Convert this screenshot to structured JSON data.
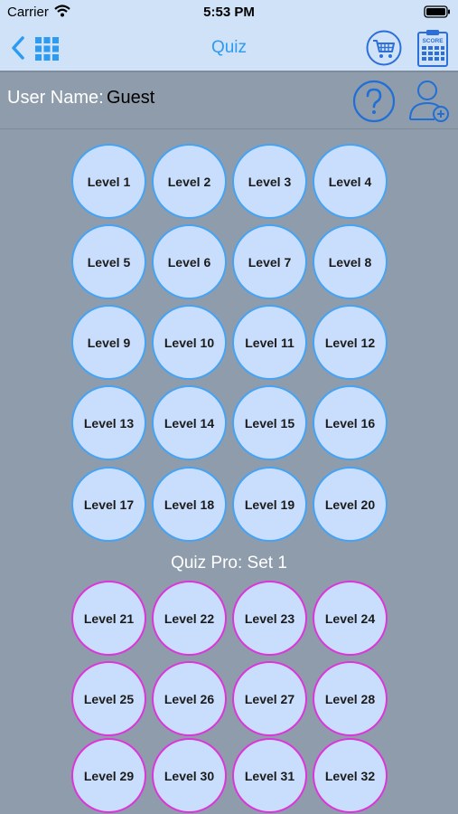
{
  "status_bar": {
    "carrier": "Carrier",
    "time": "5:53 PM",
    "wifi_icon": "wifi-icon",
    "battery_icon": "battery-icon"
  },
  "nav": {
    "title": "Quiz",
    "back_icon": "chevron-left-icon",
    "menu_icon": "grid-icon",
    "cart_icon": "cart-icon",
    "score_icon": "score-icon",
    "accent_color": "#2d9bf0"
  },
  "user": {
    "label": "User Name:",
    "value": "Guest",
    "help_icon": "question-mark-icon",
    "add_user_icon": "add-user-icon"
  },
  "levels": {
    "free": [
      "Level 1",
      "Level 2",
      "Level 3",
      "Level 4",
      "Level 5",
      "Level 6",
      "Level 7",
      "Level 8",
      "Level 9",
      "Level 10",
      "Level 11",
      "Level 12",
      "Level 13",
      "Level 14",
      "Level 15",
      "Level 16",
      "Level 17",
      "Level 18",
      "Level 19",
      "Level 20"
    ],
    "section_title": "Quiz Pro: Set 1",
    "pro": [
      "Level 21",
      "Level 22",
      "Level 23",
      "Level 24",
      "Level 25",
      "Level 26",
      "Level 27",
      "Level 28",
      "Level 29",
      "Level 30",
      "Level 31",
      "Level 32"
    ],
    "free_border_color": "#44a3f4",
    "pro_border_color": "#dc35dc",
    "circle_fill_color": "#c9defc"
  }
}
